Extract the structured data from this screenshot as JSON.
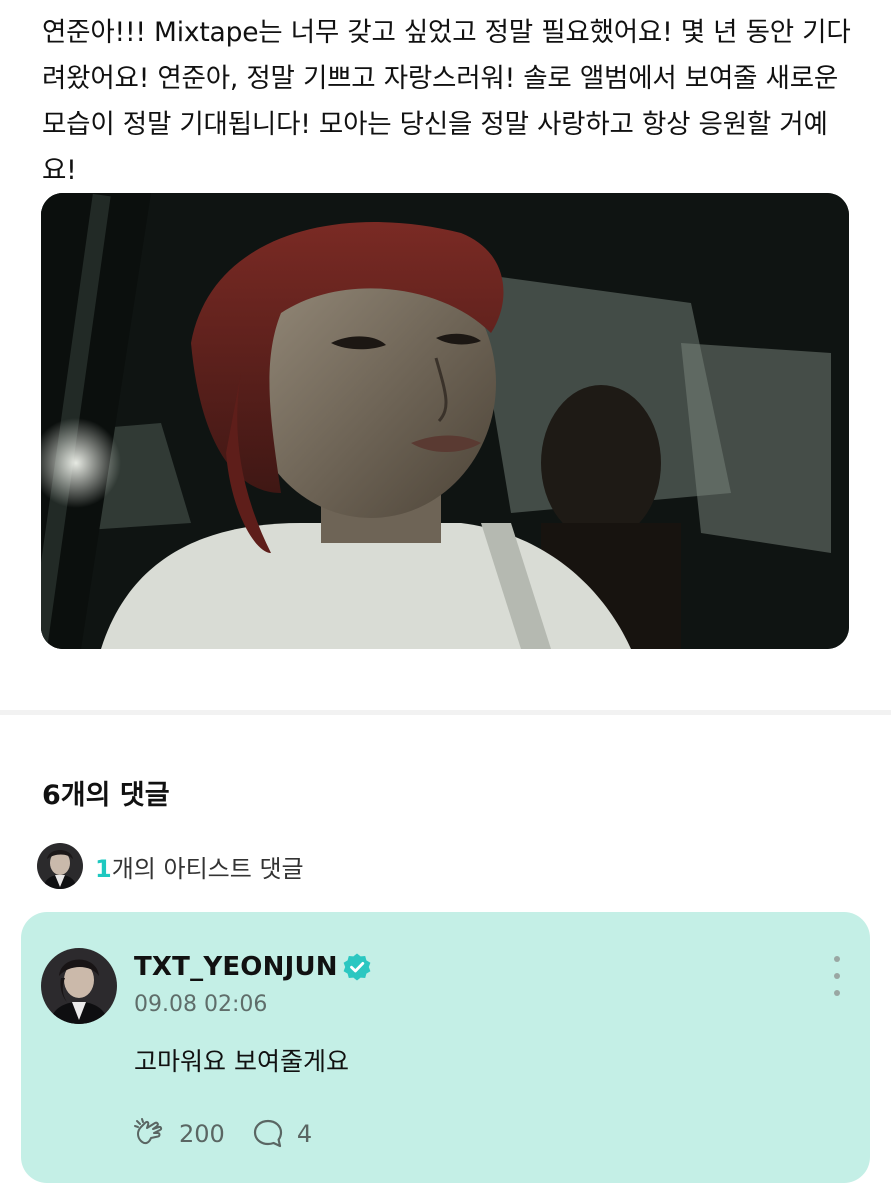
{
  "post": {
    "text": "연준아!!! Mixtape는 너무 갖고 싶었고 정말 필요했어요! 몇 년 동안 기다려왔어요! 연준아, 정말 기쁘고 자랑스러워! 솔로 앨범에서 보여줄 새로운 모습이 정말 기대됩니다! 모아는 당신을 정말 사랑하고 항상 응원할 거예요!"
  },
  "comments": {
    "heading": "6개의 댓글",
    "artist_summary": {
      "count": "1",
      "label": "개의 아티스트 댓글"
    }
  },
  "artist_comment": {
    "username": "TXT_YEONJUN",
    "timestamp": "09.08 02:06",
    "body": "고마워요 보여줄게요",
    "like_count": "200",
    "reply_count": "4"
  },
  "colors": {
    "accent": "#1ec8c0",
    "card_background": "#c4efe6",
    "verified_badge": "#2bc7c1"
  },
  "icons": {
    "verified": "verified-check-icon",
    "more": "more-vertical-icon",
    "like": "like-hands-icon",
    "reply": "speech-bubble-icon"
  }
}
